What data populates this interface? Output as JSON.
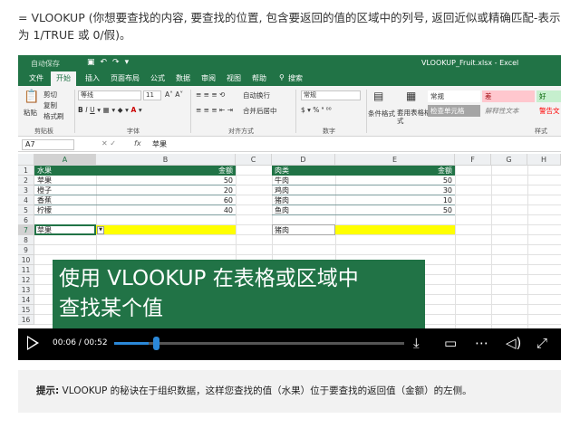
{
  "intro": "= VLOOKUP (你想要查找的内容, 要查找的位置, 包含要返回的值的区域中的列号, 返回近似或精确匹配-表示为 1/TRUE 或 0/假)。",
  "excel": {
    "autosave": "自动保存",
    "doc_title": "VLOOKUP_Fruit.xlsx - Excel",
    "tabs": [
      "文件",
      "开始",
      "插入",
      "页面布局",
      "公式",
      "数据",
      "审阅",
      "视图",
      "帮助",
      "搜索"
    ],
    "ribbon": {
      "clipboard": {
        "paste": "粘贴",
        "cut": "剪切",
        "copy": "复制",
        "format_painter": "格式刷",
        "group": "剪贴板"
      },
      "font": {
        "name": "等线",
        "size": "11",
        "group": "字体"
      },
      "alignment": {
        "wrap": "自动换行",
        "merge": "合并后居中",
        "group": "对齐方式"
      },
      "number": {
        "format": "常规",
        "group": "数字"
      },
      "styles": {
        "conditional": "条件格式",
        "table": "套用表格格式",
        "normal": "常规",
        "bad": "差",
        "good": "好",
        "check": "检查单元格",
        "explanatory": "解释性文本",
        "warning": "警告文",
        "group": "样式"
      }
    },
    "formula_bar": {
      "name_box": "A7",
      "fx": "fx",
      "value": "苹果"
    },
    "columns": [
      "A",
      "B",
      "C",
      "D",
      "E",
      "F",
      "G",
      "H"
    ],
    "rows": [
      "1",
      "2",
      "3",
      "4",
      "5",
      "6",
      "7",
      "8",
      "9",
      "10",
      "11",
      "12",
      "13",
      "14",
      "15",
      "16"
    ],
    "table1": {
      "headers": [
        "水果",
        "金额"
      ],
      "rows": [
        [
          "苹果",
          "50"
        ],
        [
          "橙子",
          "20"
        ],
        [
          "香蕉",
          "60"
        ],
        [
          "柠檬",
          "40"
        ]
      ]
    },
    "table2": {
      "headers": [
        "肉类",
        "金额"
      ],
      "rows": [
        [
          "牛肉",
          "50"
        ],
        [
          "鸡肉",
          "30"
        ],
        [
          "猪肉",
          "10"
        ],
        [
          "鱼肉",
          "50"
        ]
      ]
    },
    "lookup1": "苹果",
    "lookup2": "猪肉",
    "caption": [
      "使用 VLOOKUP 在表格或区域中",
      "查找某个值"
    ]
  },
  "player": {
    "time": "00:06 / 00:52",
    "progress": 0.12,
    "icons": [
      "play-icon",
      "download-icon",
      "captions-icon",
      "more-icon",
      "volume-icon",
      "fullscreen-icon"
    ]
  },
  "tip": {
    "label": "提示:",
    "text": " VLOOKUP 的秘诀在于组织数据，这样您查找的值（水果）位于要查找的返回值（金额）的左侧。"
  },
  "colors": {
    "excel_green": "#217346",
    "highlight": "#ffff00",
    "progress": "#2b88d8"
  }
}
